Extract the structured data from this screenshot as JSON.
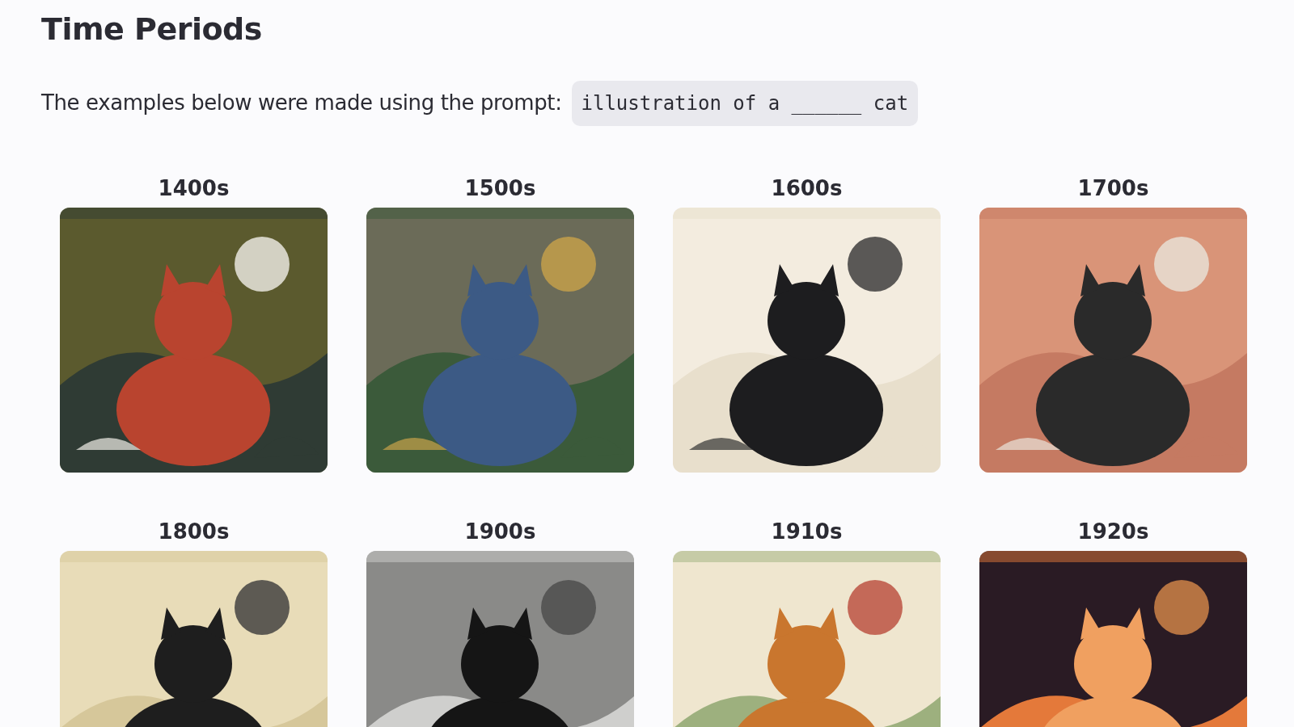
{
  "title": "Time Periods",
  "intro": {
    "text": "The examples below were made using the prompt:",
    "prompt": "illustration of a ______ cat"
  },
  "examples": [
    {
      "label": "1400s",
      "kind": "picture"
    },
    {
      "label": "1500s",
      "kind": "picture"
    },
    {
      "label": "1600s",
      "kind": "picture"
    },
    {
      "label": "1700s",
      "kind": "picture"
    },
    {
      "label": "1800s",
      "kind": "picture"
    },
    {
      "label": "1900s",
      "kind": "picture"
    },
    {
      "label": "1910s",
      "kind": "picture"
    },
    {
      "label": "1920s",
      "kind": "picture"
    }
  ]
}
